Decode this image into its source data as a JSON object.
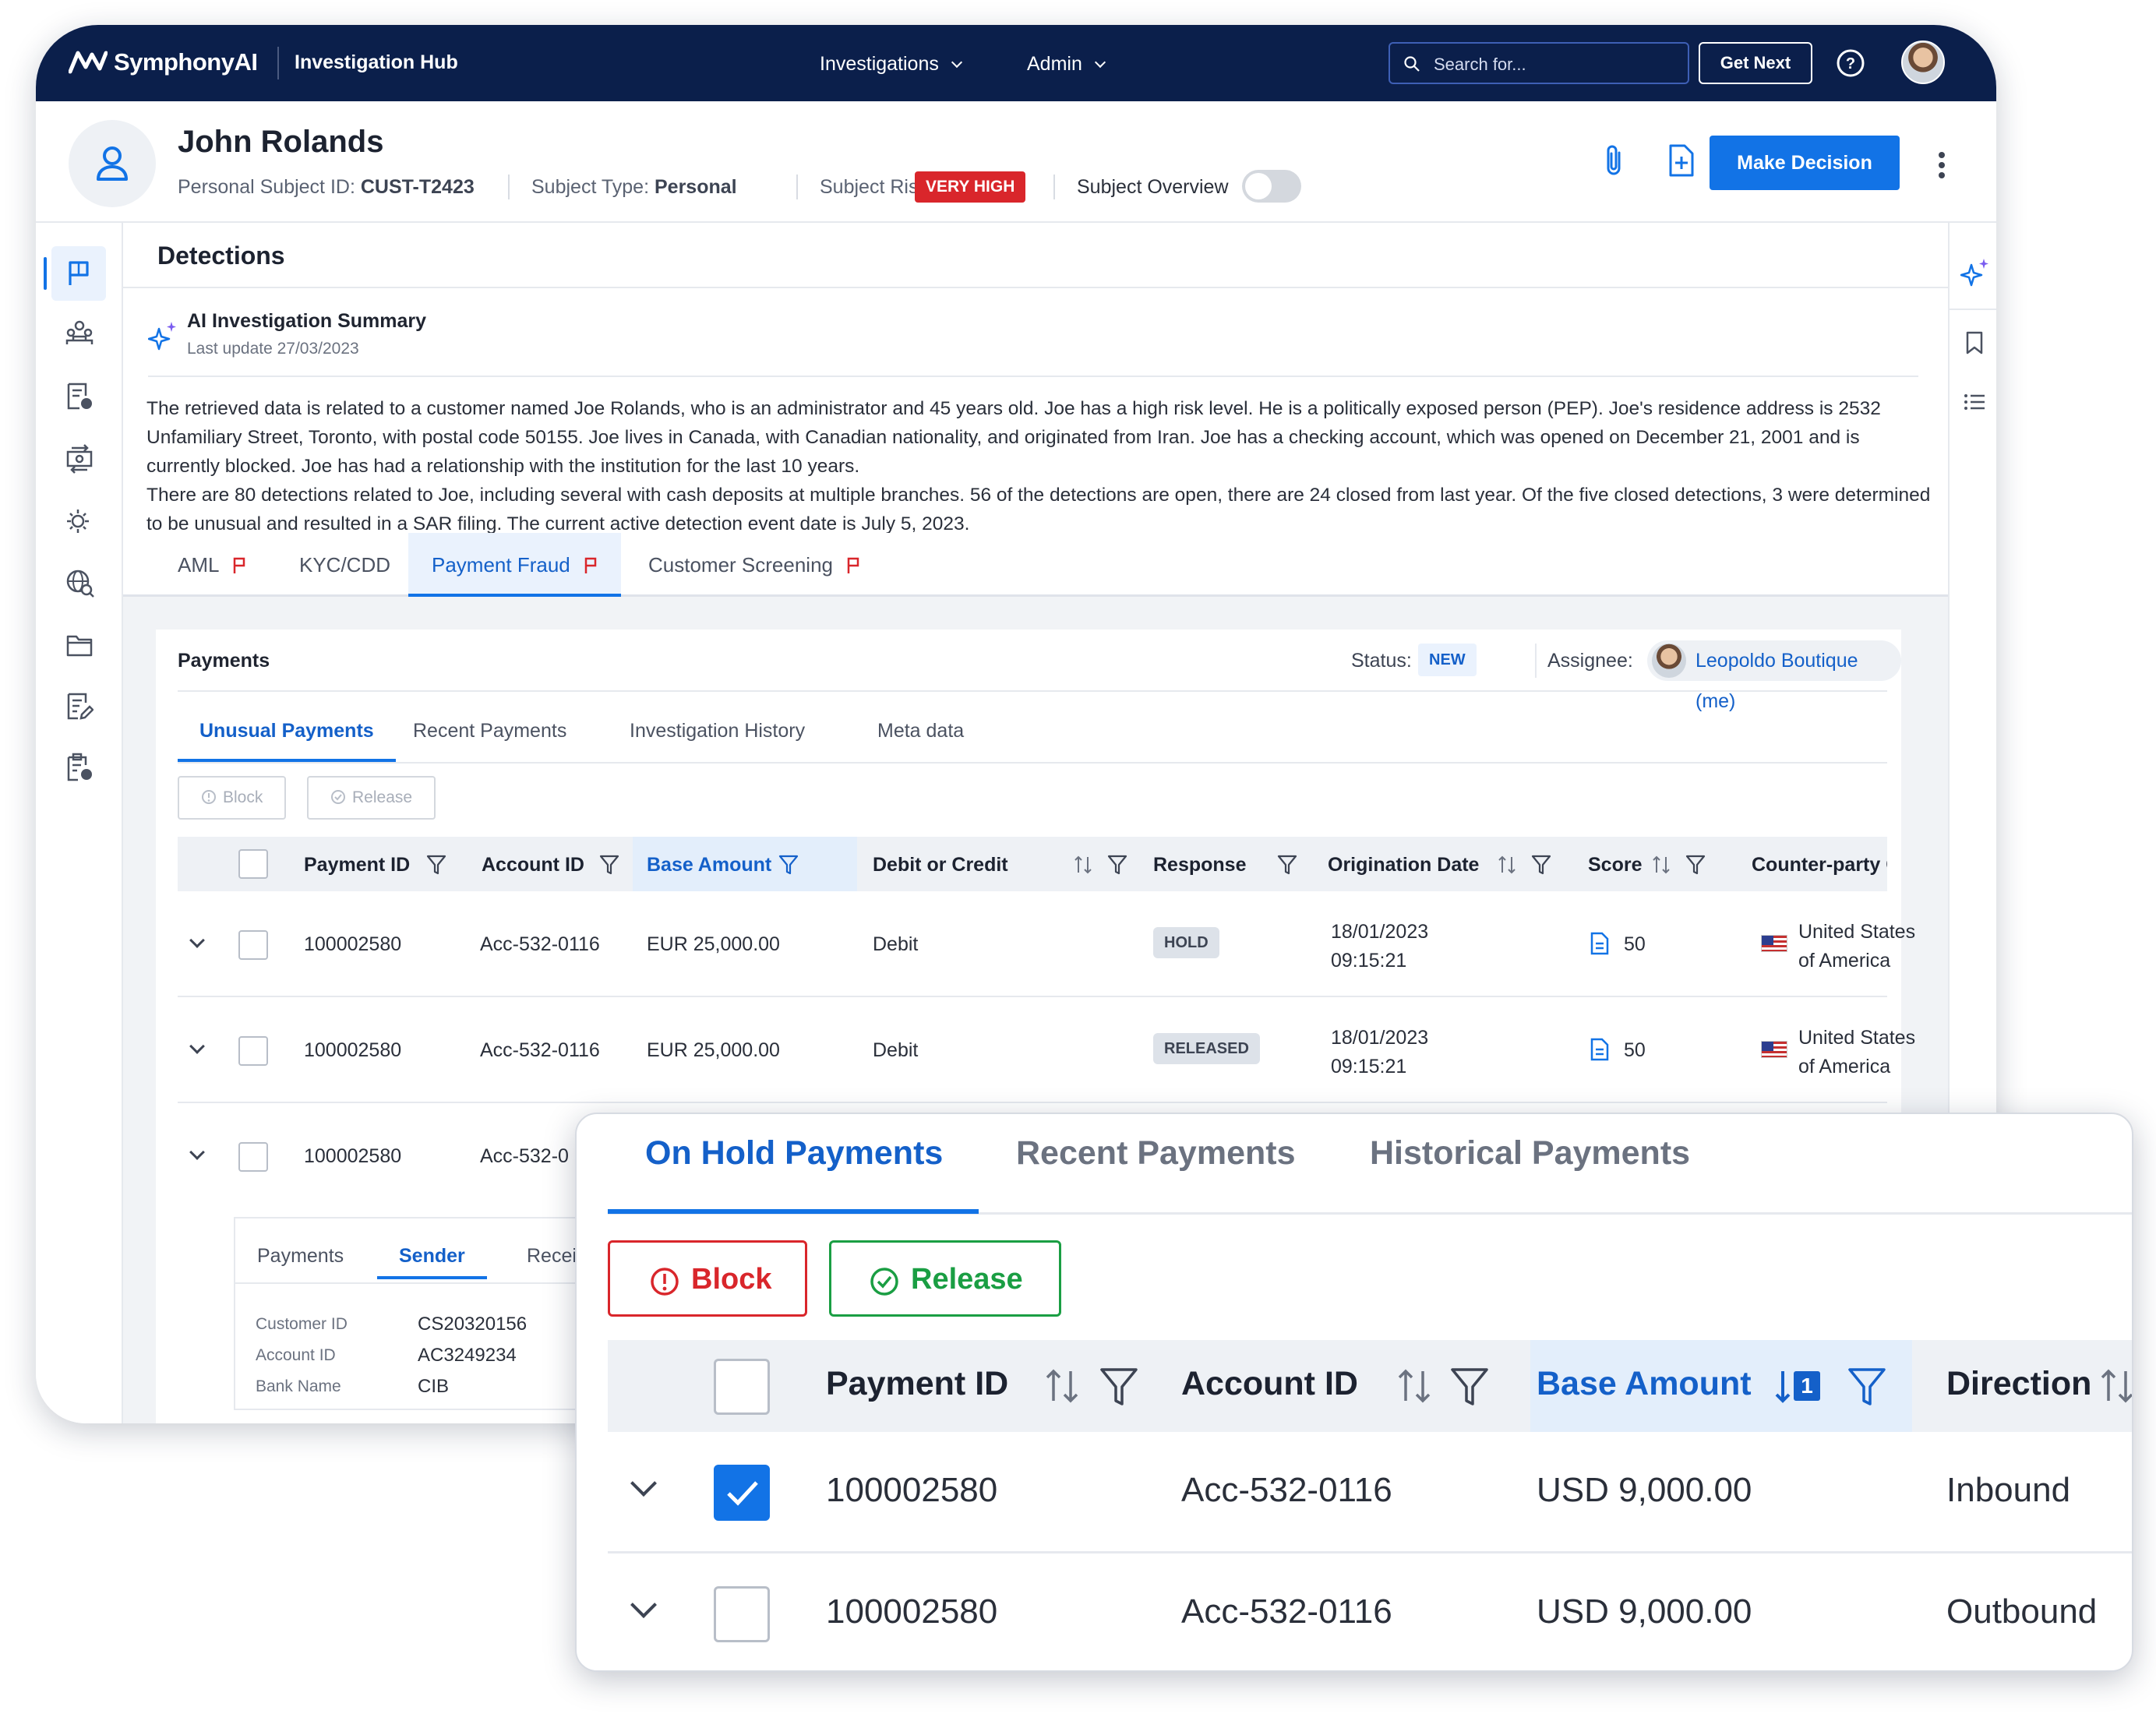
{
  "nav": {
    "brand": "SymphonyAI",
    "app_name": "Investigation Hub",
    "menus": [
      "Investigations",
      "Admin"
    ],
    "search_placeholder": "Search for...",
    "get_next": "Get Next"
  },
  "subject": {
    "name": "John Rolands",
    "id_label": "Personal Subject ID:",
    "id_value": "CUST-T2423",
    "type_label": "Subject Type:",
    "type_value": "Personal",
    "risk_label": "Subject Risk:",
    "risk_value": "VERY HIGH",
    "overview_label": "Subject Overview",
    "overview_on": false,
    "make_decision": "Make Decision"
  },
  "detections": {
    "title": "Detections",
    "ai_title": "AI Investigation Summary",
    "ai_date": "Last update 27/03/2023",
    "ai_text_1": "The retrieved data is related to a customer named Joe Rolands, who is an administrator and 45 years old.  Joe has a high risk level. He is a politically exposed person (PEP). Joe's residence address is 2532 Unfamiliary Street, Toronto, with postal code 50155. Joe lives in Canada, with  Canadian nationality, and originated from Iran.  Joe has a checking account, which was opened on December 21, 2001 and is currently blocked. Joe has had a relationship with the institution for the last 10 years.",
    "ai_text_2": "There are 80 detections related to Joe, including several with cash deposits at multiple branches. 56 of the detections are open, there are 24 closed from last year. Of the five closed detections, 3 were determined to be unusual and resulted in a SAR filing.  The current active detection event date is July 5, 2023.",
    "tabs": [
      "AML",
      "KYC/CDD",
      "Payment Fraud",
      "Customer Screening"
    ]
  },
  "payments": {
    "title": "Payments",
    "status_label": "Status:",
    "status_value": "NEW",
    "assignee_label": "Assignee:",
    "assignee_value": "Leopoldo Boutique (me)",
    "subtabs": [
      "Unusual Payments",
      "Recent Payments",
      "Investigation History",
      "Meta data"
    ],
    "block": "Block",
    "release": "Release",
    "columns": [
      "Payment ID",
      "Account ID",
      "Base Amount",
      "Debit or Credit",
      "Response",
      "Origination Date",
      "Score",
      "Counter-party Count"
    ],
    "rows": [
      {
        "payment_id": "100002580",
        "account_id": "Acc-532-0116",
        "amount": "EUR 25,000.00",
        "dc": "Debit",
        "response": "HOLD",
        "date": "18/01/2023",
        "time": "09:15:21",
        "score": "50",
        "country_1": "United States",
        "country_2": "of America"
      },
      {
        "payment_id": "100002580",
        "account_id": "Acc-532-0116",
        "amount": "EUR 25,000.00",
        "dc": "Debit",
        "response": "RELEASED",
        "date": "18/01/2023",
        "time": "09:15:21",
        "score": "50",
        "country_1": "United States",
        "country_2": "of America"
      },
      {
        "payment_id": "100002580",
        "account_id": "Acc-532-0"
      }
    ],
    "detail": {
      "tabs": [
        "Payments",
        "Sender",
        "Recei"
      ],
      "fields": [
        {
          "label": "Customer ID",
          "value": "CS20320156"
        },
        {
          "label": "Account ID",
          "value": "AC3249234"
        },
        {
          "label": "Bank Name",
          "value": "CIB"
        }
      ]
    }
  },
  "zoom": {
    "tabs": [
      "On Hold Payments",
      "Recent Payments",
      "Historical Payments"
    ],
    "block": "Block",
    "release": "Release",
    "columns": [
      "Payment ID",
      "Account ID",
      "Base Amount",
      "Direction"
    ],
    "sort_badge": "1",
    "rows": [
      {
        "payment_id": "100002580",
        "account_id": "Acc-532-0116",
        "amount": "USD 9,000.00",
        "direction": "Inbound",
        "checked": true
      },
      {
        "payment_id": "100002580",
        "account_id": "Acc-532-0116",
        "amount": "USD 9,000.00",
        "direction": "Outbound",
        "checked": false
      }
    ]
  },
  "colors": {
    "nav_bg": "#0b1f4b",
    "accent": "#1273e6",
    "risk": "#d9262b",
    "release": "#1a9e43"
  }
}
